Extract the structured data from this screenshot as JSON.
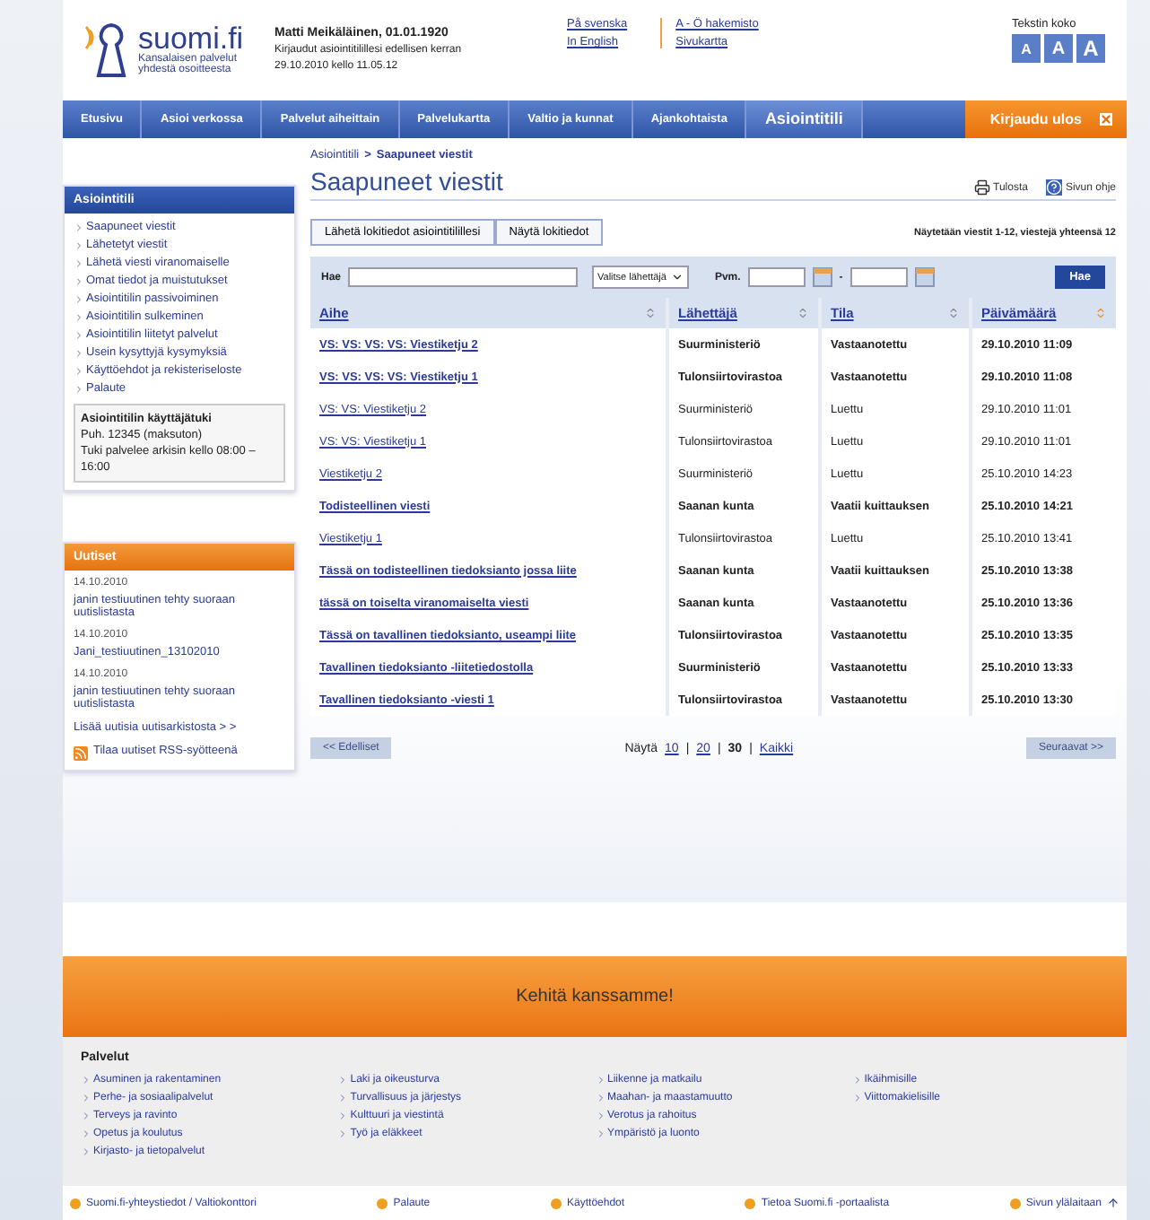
{
  "header": {
    "logo": {
      "name": "suomi.fi",
      "tagline": [
        "Kansalaisen palvelut",
        "yhdestä osoitteesta"
      ]
    },
    "user": {
      "name": "Matti Meikäläinen, 01.01.1920",
      "lines": [
        "Kirjaudut asiointitilillesi edellisen kerran",
        "29.10.2010 kello 11.05.12"
      ]
    },
    "language_links": [
      "På svenska",
      "In English"
    ],
    "site_links": [
      "A - Ö hakemisto",
      "Sivukartta"
    ],
    "text_size": {
      "label": "Tekstin koko",
      "buttons": [
        "A",
        "A",
        "A"
      ]
    }
  },
  "nav": {
    "items": [
      {
        "label": "Etusivu",
        "selected": false
      },
      {
        "label": "Asioi verkossa",
        "selected": false
      },
      {
        "label": "Palvelut aiheittain",
        "selected": false
      },
      {
        "label": "Palvelukartta",
        "selected": false
      },
      {
        "label": "Valtio ja kunnat",
        "selected": false
      },
      {
        "label": "Ajankohtaista",
        "selected": false
      },
      {
        "label": "Asiointitili",
        "selected": true
      }
    ],
    "logout": "Kirjaudu ulos"
  },
  "sidebar": {
    "title": "Asiointitili",
    "links": [
      "Saapuneet viestit",
      "Lähetetyt viestit",
      "Lähetä viesti viranomaiselle",
      "Omat tiedot ja muistutukset",
      "Asiointitilin passivoiminen",
      "Asiointitilin sulkeminen",
      "Asiointitilin liitetyt palvelut",
      "Usein kysyttyjä kysymyksiä",
      "Käyttöehdot ja rekisteriseloste",
      "Palaute"
    ],
    "support": {
      "title": "Asiointitilin käyttäjätuki",
      "lines": [
        "Puh. 12345 (maksuton)",
        "Tuki palvelee arkisin kello 08:00 – 16:00"
      ]
    }
  },
  "news": {
    "title": "Uutiset",
    "items": [
      {
        "date": "14.10.2010",
        "title": "janin testiuutinen tehty suoraan uutislistasta"
      },
      {
        "date": "14.10.2010",
        "title": "Jani_testiuutinen_13102010"
      },
      {
        "date": "14.10.2010",
        "title": "janin testiuutinen tehty suoraan uutislistasta"
      }
    ],
    "more": "Lisää uutisia uutisarkistosta > >",
    "rss": "Tilaa uutiset RSS-syötteenä"
  },
  "main": {
    "breadcrumb": [
      "Asiointitili",
      ">",
      "Saapuneet viestit"
    ],
    "title": "Saapuneet viestit",
    "print": "Tulosta",
    "help": "Sivun ohje",
    "log_buttons": [
      "Lähetä lokitiedot asiointitilillesi",
      "Näytä lokitiedot"
    ],
    "count": "Näytetään viestit 1-12, viestejä yhteensä 12",
    "filter": {
      "search_label": "Hae",
      "sender_select": "Valitse lähettäjä",
      "date_label": "Pvm.",
      "separator": "-",
      "button": "Hae"
    },
    "table": {
      "columns": [
        {
          "label": "Aihe",
          "sorted": false
        },
        {
          "label": "Lähettäjä",
          "sorted": false
        },
        {
          "label": "Tila",
          "sorted": false
        },
        {
          "label": "Päivämäärä",
          "sorted": true
        }
      ],
      "rows": [
        {
          "subject": "VS: VS: VS: VS: Viestiketju 2",
          "sender": "Suurministeriö",
          "status": "Vastaanotettu",
          "date": "29.10.2010 11:09",
          "unread": true
        },
        {
          "subject": "VS: VS: VS: VS: Viestiketju 1",
          "sender": "Tulonsiirtovirastoa",
          "status": "Vastaanotettu",
          "date": "29.10.2010 11:08",
          "unread": true
        },
        {
          "subject": "VS: VS: Viestiketju 2",
          "sender": "Suurministeriö",
          "status": "Luettu",
          "date": "29.10.2010 11:01",
          "unread": false
        },
        {
          "subject": "VS: VS: Viestiketju 1",
          "sender": "Tulonsiirtovirastoa",
          "status": "Luettu",
          "date": "29.10.2010 11:01",
          "unread": false
        },
        {
          "subject": "Viestiketju 2",
          "sender": "Suurministeriö",
          "status": "Luettu",
          "date": "25.10.2010 14:23",
          "unread": false
        },
        {
          "subject": "Todisteellinen viesti",
          "sender": "Saanan kunta",
          "status": "Vaatii kuittauksen",
          "date": "25.10.2010 14:21",
          "unread": true
        },
        {
          "subject": "Viestiketju 1",
          "sender": "Tulonsiirtovirastoa",
          "status": "Luettu",
          "date": "25.10.2010 13:41",
          "unread": false
        },
        {
          "subject": "Tässä on todisteellinen tiedoksianto jossa liite",
          "sender": "Saanan kunta",
          "status": "Vaatii kuittauksen",
          "date": "25.10.2010 13:38",
          "unread": true
        },
        {
          "subject": "tässä on toiselta viranomaiselta viesti",
          "sender": "Saanan kunta",
          "status": "Vastaanotettu",
          "date": "25.10.2010 13:36",
          "unread": true
        },
        {
          "subject": "Tässä on tavallinen tiedoksianto, useampi liite",
          "sender": "Tulonsiirtovirastoa",
          "status": "Vastaanotettu",
          "date": "25.10.2010 13:35",
          "unread": true
        },
        {
          "subject": "Tavallinen tiedoksianto -liitetiedostolla",
          "sender": "Suurministeriö",
          "status": "Vastaanotettu",
          "date": "25.10.2010 13:33",
          "unread": true
        },
        {
          "subject": "Tavallinen tiedoksianto -viesti 1",
          "sender": "Tulonsiirtovirastoa",
          "status": "Vastaanotettu",
          "date": "25.10.2010 13:30",
          "unread": true
        }
      ]
    },
    "pager": {
      "prev": {
        "label": "<< Edelliset",
        "disabled": true
      },
      "show_label": "Näytä",
      "sizes": [
        {
          "label": "10",
          "selected": false
        },
        {
          "label": "20",
          "selected": false
        },
        {
          "label": "30",
          "selected": true
        },
        {
          "label": "Kaikki",
          "selected": false
        }
      ],
      "separator": "|",
      "next": {
        "label": "Seuraavat >>",
        "disabled": true
      }
    }
  },
  "banner": "Kehitä kanssamme!",
  "services": {
    "title": "Palvelut",
    "columns": [
      [
        "Asuminen ja rakentaminen",
        "Perhe- ja sosiaalipalvelut",
        "Terveys ja ravinto",
        "Opetus ja koulutus",
        "Kirjasto- ja tietopalvelut"
      ],
      [
        "Laki ja oikeusturva",
        "Turvallisuus ja järjestys",
        "Kulttuuri ja viestintä",
        "Työ ja eläkkeet"
      ],
      [
        "Liikenne ja matkailu",
        "Maahan- ja maastamuutto",
        "Verotus ja rahoitus",
        "Ympäristö ja luonto"
      ],
      [
        "Ikäihmisille",
        "Viittomakielisille"
      ]
    ]
  },
  "footer_links": [
    "Suomi.fi-yhteystiedot / Valtiokonttori",
    "Palaute",
    "Käyttöehdot",
    "Tietoa Suomi.fi -portaalista"
  ],
  "to_top": "Sivun ylälaitaan"
}
